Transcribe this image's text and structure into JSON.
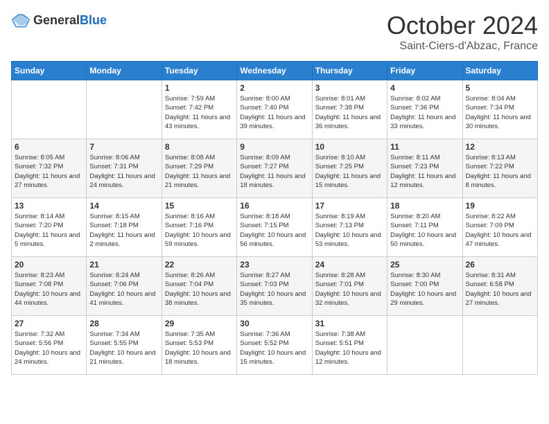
{
  "header": {
    "logo_general": "General",
    "logo_blue": "Blue",
    "month": "October 2024",
    "location": "Saint-Ciers-d'Abzac, France"
  },
  "weekdays": [
    "Sunday",
    "Monday",
    "Tuesday",
    "Wednesday",
    "Thursday",
    "Friday",
    "Saturday"
  ],
  "weeks": [
    [
      {
        "day": "",
        "info": ""
      },
      {
        "day": "",
        "info": ""
      },
      {
        "day": "1",
        "info": "Sunrise: 7:59 AM\nSunset: 7:42 PM\nDaylight: 11 hours and 43 minutes."
      },
      {
        "day": "2",
        "info": "Sunrise: 8:00 AM\nSunset: 7:40 PM\nDaylight: 11 hours and 39 minutes."
      },
      {
        "day": "3",
        "info": "Sunrise: 8:01 AM\nSunset: 7:38 PM\nDaylight: 11 hours and 36 minutes."
      },
      {
        "day": "4",
        "info": "Sunrise: 8:02 AM\nSunset: 7:36 PM\nDaylight: 11 hours and 33 minutes."
      },
      {
        "day": "5",
        "info": "Sunrise: 8:04 AM\nSunset: 7:34 PM\nDaylight: 11 hours and 30 minutes."
      }
    ],
    [
      {
        "day": "6",
        "info": "Sunrise: 8:05 AM\nSunset: 7:32 PM\nDaylight: 11 hours and 27 minutes."
      },
      {
        "day": "7",
        "info": "Sunrise: 8:06 AM\nSunset: 7:31 PM\nDaylight: 11 hours and 24 minutes."
      },
      {
        "day": "8",
        "info": "Sunrise: 8:08 AM\nSunset: 7:29 PM\nDaylight: 11 hours and 21 minutes."
      },
      {
        "day": "9",
        "info": "Sunrise: 8:09 AM\nSunset: 7:27 PM\nDaylight: 11 hours and 18 minutes."
      },
      {
        "day": "10",
        "info": "Sunrise: 8:10 AM\nSunset: 7:25 PM\nDaylight: 11 hours and 15 minutes."
      },
      {
        "day": "11",
        "info": "Sunrise: 8:11 AM\nSunset: 7:23 PM\nDaylight: 11 hours and 12 minutes."
      },
      {
        "day": "12",
        "info": "Sunrise: 8:13 AM\nSunset: 7:22 PM\nDaylight: 11 hours and 8 minutes."
      }
    ],
    [
      {
        "day": "13",
        "info": "Sunrise: 8:14 AM\nSunset: 7:20 PM\nDaylight: 11 hours and 5 minutes."
      },
      {
        "day": "14",
        "info": "Sunrise: 8:15 AM\nSunset: 7:18 PM\nDaylight: 11 hours and 2 minutes."
      },
      {
        "day": "15",
        "info": "Sunrise: 8:16 AM\nSunset: 7:16 PM\nDaylight: 10 hours and 59 minutes."
      },
      {
        "day": "16",
        "info": "Sunrise: 8:18 AM\nSunset: 7:15 PM\nDaylight: 10 hours and 56 minutes."
      },
      {
        "day": "17",
        "info": "Sunrise: 8:19 AM\nSunset: 7:13 PM\nDaylight: 10 hours and 53 minutes."
      },
      {
        "day": "18",
        "info": "Sunrise: 8:20 AM\nSunset: 7:11 PM\nDaylight: 10 hours and 50 minutes."
      },
      {
        "day": "19",
        "info": "Sunrise: 8:22 AM\nSunset: 7:09 PM\nDaylight: 10 hours and 47 minutes."
      }
    ],
    [
      {
        "day": "20",
        "info": "Sunrise: 8:23 AM\nSunset: 7:08 PM\nDaylight: 10 hours and 44 minutes."
      },
      {
        "day": "21",
        "info": "Sunrise: 8:24 AM\nSunset: 7:06 PM\nDaylight: 10 hours and 41 minutes."
      },
      {
        "day": "22",
        "info": "Sunrise: 8:26 AM\nSunset: 7:04 PM\nDaylight: 10 hours and 38 minutes."
      },
      {
        "day": "23",
        "info": "Sunrise: 8:27 AM\nSunset: 7:03 PM\nDaylight: 10 hours and 35 minutes."
      },
      {
        "day": "24",
        "info": "Sunrise: 8:28 AM\nSunset: 7:01 PM\nDaylight: 10 hours and 32 minutes."
      },
      {
        "day": "25",
        "info": "Sunrise: 8:30 AM\nSunset: 7:00 PM\nDaylight: 10 hours and 29 minutes."
      },
      {
        "day": "26",
        "info": "Sunrise: 8:31 AM\nSunset: 6:58 PM\nDaylight: 10 hours and 27 minutes."
      }
    ],
    [
      {
        "day": "27",
        "info": "Sunrise: 7:32 AM\nSunset: 5:56 PM\nDaylight: 10 hours and 24 minutes."
      },
      {
        "day": "28",
        "info": "Sunrise: 7:34 AM\nSunset: 5:55 PM\nDaylight: 10 hours and 21 minutes."
      },
      {
        "day": "29",
        "info": "Sunrise: 7:35 AM\nSunset: 5:53 PM\nDaylight: 10 hours and 18 minutes."
      },
      {
        "day": "30",
        "info": "Sunrise: 7:36 AM\nSunset: 5:52 PM\nDaylight: 10 hours and 15 minutes."
      },
      {
        "day": "31",
        "info": "Sunrise: 7:38 AM\nSunset: 5:51 PM\nDaylight: 10 hours and 12 minutes."
      },
      {
        "day": "",
        "info": ""
      },
      {
        "day": "",
        "info": ""
      }
    ]
  ]
}
